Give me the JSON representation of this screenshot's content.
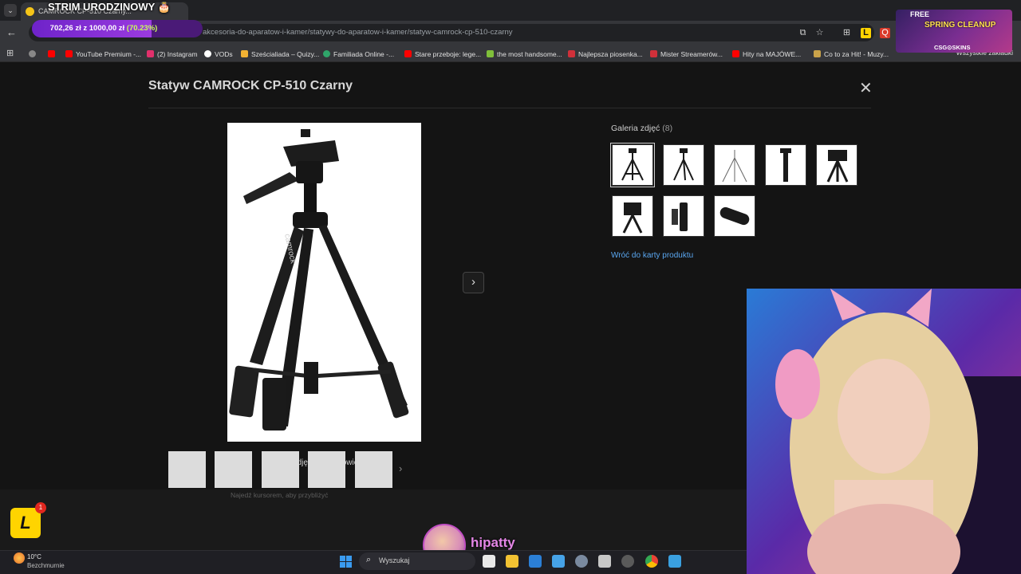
{
  "browser": {
    "tab_title": "CAMROCK CP-510 Czarny...",
    "url": "akcesoria-do-aparatow-i-kamer/statywy-do-aparatow-i-kamer/statyw-camrock-cp-510-czarny",
    "bookmarks": [
      {
        "label": "YouTube Premium -...",
        "color": "#ff0000"
      },
      {
        "label": "(2) Instagram",
        "color": "#e1306c"
      },
      {
        "label": "VODs",
        "color": "#ffffff"
      },
      {
        "label": "Sześcialiada – Quizy...",
        "color": "#f2b233"
      },
      {
        "label": "Familiada Online -...",
        "color": "#2fa56a"
      },
      {
        "label": "Stare przeboje: lege...",
        "color": "#ff0000"
      },
      {
        "label": "the most handsome...",
        "color": "#7fbf3a"
      },
      {
        "label": "Najlepsza piosenka...",
        "color": "#d0303a"
      },
      {
        "label": "Mister Streamerów...",
        "color": "#d0303a"
      },
      {
        "label": "Hity na MAJÓWE...",
        "color": "#ff0000"
      },
      {
        "label": "Co to za Hit! - Muzy...",
        "color": "#c9a24a"
      }
    ],
    "all_bookmarks": "Wszystkie zakładki"
  },
  "modal": {
    "title": "Statyw CAMROCK CP-510 Czarny",
    "caption": "Kliknij zdjęcie, aby powiększyć",
    "hover_hint": "Najedź kursorem, aby przybliżyć",
    "gallery_heading": "Galeria zdjęć",
    "gallery_count": "(8)",
    "back_link": "Wróć do karty produktu",
    "photo_brand": "camrock",
    "thumbnails": [
      "tripod-front",
      "tripod-angle",
      "tripod-light",
      "tripod-monopod",
      "tripod-head",
      "tripod-head-closeup",
      "phone-holder",
      "carry-bag"
    ]
  },
  "stream": {
    "banner": "STRIM URODZINOWY",
    "goal_text": "702,26 zł z 1000,00 zł",
    "goal_percent_label": "(70.23%)",
    "goal_progress": 0.7023,
    "promo_free": "FREE",
    "promo_title": "SPRING CLEANUP",
    "promo_brand": "CSG⊙SKINS",
    "streamer_name": "hipatty",
    "badge_letter": "L",
    "badge_count": "1"
  },
  "taskbar": {
    "temperature": "10°C",
    "weather": "Bezchmurnie",
    "search_label": "Wyszukaj"
  }
}
